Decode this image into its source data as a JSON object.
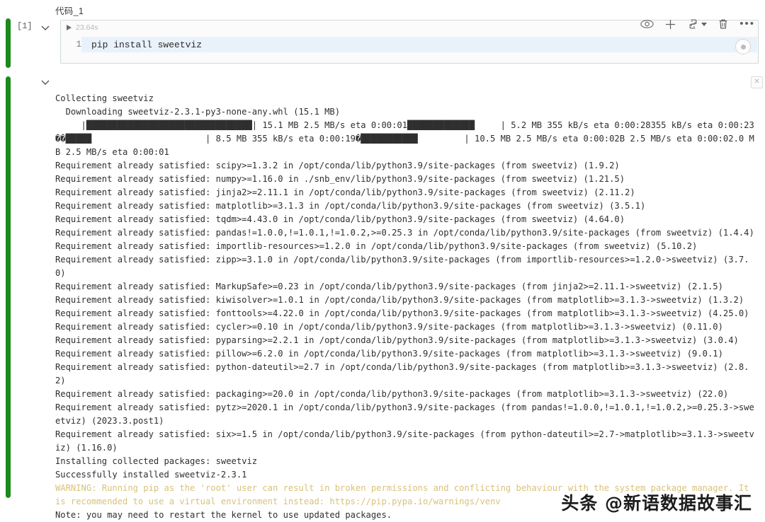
{
  "cell": {
    "title": "代码_1",
    "exec_count": "[1]",
    "runtime": "23.64s",
    "line_number": "1",
    "code": "pip install sweetviz"
  },
  "toolbar": {
    "preview_icon": "eye-icon",
    "add_icon": "plus-icon",
    "kernel_icon": "python-kernel-icon",
    "delete_icon": "trash-icon",
    "more_icon": "ellipsis-icon",
    "dots_label": "•••",
    "close_label": "✕"
  },
  "output": {
    "lines": [
      {
        "style": "plain",
        "text": "Collecting sweetviz"
      },
      {
        "style": "plain",
        "text": "  Downloading sweetviz-2.3.1-py3-none-any.whl (15.1 MB)"
      },
      {
        "style": "plain",
        "text": "     |████████████████████████████████| 15.1 MB 2.5 MB/s eta 0:00:01█████████████     | 5.2 MB 355 kB/s eta 0:00:28355 kB/s eta 0:00:23��█████                      | 8.5 MB 355 kB/s eta 0:00:19�███████████         | 10.5 MB 2.5 MB/s eta 0:00:02B 2.5 MB/s eta 0:00:02.0 MB 2.5 MB/s eta 0:00:01"
      },
      {
        "style": "plain",
        "text": "Requirement already satisfied: scipy>=1.3.2 in /opt/conda/lib/python3.9/site-packages (from sweetviz) (1.9.2)"
      },
      {
        "style": "plain",
        "text": "Requirement already satisfied: numpy>=1.16.0 in ./snb_env/lib/python3.9/site-packages (from sweetviz) (1.21.5)"
      },
      {
        "style": "plain",
        "text": "Requirement already satisfied: jinja2>=2.11.1 in /opt/conda/lib/python3.9/site-packages (from sweetviz) (2.11.2)"
      },
      {
        "style": "plain",
        "text": "Requirement already satisfied: matplotlib>=3.1.3 in /opt/conda/lib/python3.9/site-packages (from sweetviz) (3.5.1)"
      },
      {
        "style": "plain",
        "text": "Requirement already satisfied: tqdm>=4.43.0 in /opt/conda/lib/python3.9/site-packages (from sweetviz) (4.64.0)"
      },
      {
        "style": "plain",
        "text": "Requirement already satisfied: pandas!=1.0.0,!=1.0.1,!=1.0.2,>=0.25.3 in /opt/conda/lib/python3.9/site-packages (from sweetviz) (1.4.4)"
      },
      {
        "style": "plain",
        "text": "Requirement already satisfied: importlib-resources>=1.2.0 in /opt/conda/lib/python3.9/site-packages (from sweetviz) (5.10.2)"
      },
      {
        "style": "plain",
        "text": "Requirement already satisfied: zipp>=3.1.0 in /opt/conda/lib/python3.9/site-packages (from importlib-resources>=1.2.0->sweetviz) (3.7.0)"
      },
      {
        "style": "plain",
        "text": "Requirement already satisfied: MarkupSafe>=0.23 in /opt/conda/lib/python3.9/site-packages (from jinja2>=2.11.1->sweetviz) (2.1.5)"
      },
      {
        "style": "plain",
        "text": "Requirement already satisfied: kiwisolver>=1.0.1 in /opt/conda/lib/python3.9/site-packages (from matplotlib>=3.1.3->sweetviz) (1.3.2)"
      },
      {
        "style": "plain",
        "text": "Requirement already satisfied: fonttools>=4.22.0 in /opt/conda/lib/python3.9/site-packages (from matplotlib>=3.1.3->sweetviz) (4.25.0)"
      },
      {
        "style": "plain",
        "text": "Requirement already satisfied: cycler>=0.10 in /opt/conda/lib/python3.9/site-packages (from matplotlib>=3.1.3->sweetviz) (0.11.0)"
      },
      {
        "style": "plain",
        "text": "Requirement already satisfied: pyparsing>=2.2.1 in /opt/conda/lib/python3.9/site-packages (from matplotlib>=3.1.3->sweetviz) (3.0.4)"
      },
      {
        "style": "plain",
        "text": "Requirement already satisfied: pillow>=6.2.0 in /opt/conda/lib/python3.9/site-packages (from matplotlib>=3.1.3->sweetviz) (9.0.1)"
      },
      {
        "style": "plain",
        "text": "Requirement already satisfied: python-dateutil>=2.7 in /opt/conda/lib/python3.9/site-packages (from matplotlib>=3.1.3->sweetviz) (2.8.2)"
      },
      {
        "style": "plain",
        "text": "Requirement already satisfied: packaging>=20.0 in /opt/conda/lib/python3.9/site-packages (from matplotlib>=3.1.3->sweetviz) (22.0)"
      },
      {
        "style": "plain",
        "text": "Requirement already satisfied: pytz>=2020.1 in /opt/conda/lib/python3.9/site-packages (from pandas!=1.0.0,!=1.0.1,!=1.0.2,>=0.25.3->sweetviz) (2023.3.post1)"
      },
      {
        "style": "plain",
        "text": "Requirement already satisfied: six>=1.5 in /opt/conda/lib/python3.9/site-packages (from python-dateutil>=2.7->matplotlib>=3.1.3->sweetviz) (1.16.0)"
      },
      {
        "style": "plain",
        "text": "Installing collected packages: sweetviz"
      },
      {
        "style": "plain",
        "text": "Successfully installed sweetviz-2.3.1"
      },
      {
        "style": "warn",
        "text": "WARNING: Running pip as the 'root' user can result in broken permissions and conflicting behaviour with the system package manager. It is recommended to use a virtual environment instead: https://pip.pypa.io/warnings/venv"
      },
      {
        "style": "plain",
        "text": "Note: you may need to restart the kernel to use updated packages."
      }
    ]
  },
  "watermark": {
    "text": "头条 @新语数据故事汇"
  },
  "colors": {
    "cell_accent": "#1a8a1a",
    "code_highlight": "#e9f2fa",
    "warning": "#d9c27a"
  }
}
